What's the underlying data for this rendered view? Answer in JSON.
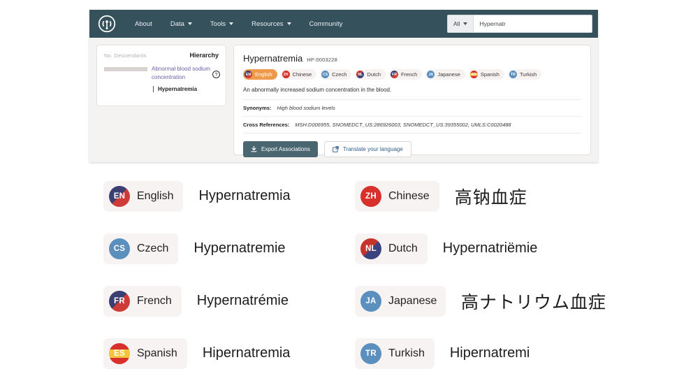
{
  "navbar": {
    "logo_icon": "broadcast-antenna-icon",
    "items": [
      {
        "label": "About",
        "has_caret": false
      },
      {
        "label": "Data",
        "has_caret": true
      },
      {
        "label": "Tools",
        "has_caret": true
      },
      {
        "label": "Resources",
        "has_caret": true
      },
      {
        "label": "Community",
        "has_caret": false
      }
    ],
    "search": {
      "scope_label": "All",
      "value": "Hypernatr",
      "placeholder": "Search"
    }
  },
  "hierarchy": {
    "descendants_label": "No. Descendants",
    "title": "Hierarchy",
    "parent_term": "Abnormal blood sodium concentration",
    "current_term": "Hypernatremia",
    "help_glyph": "?"
  },
  "term": {
    "name": "Hypernatremia",
    "id": "HP:0003228",
    "description": "An abnormally increased sodium concentration in the blood.",
    "synonyms_label": "Synonyms:",
    "synonyms_value": "High blood sodium levels",
    "xrefs_label": "Cross References:",
    "xrefs_value": "MSH:D006955, SNOMEDCT_US:286926003, SNOMEDCT_US:39355002, UMLS:C0020488",
    "chips": [
      {
        "code": "EN",
        "label": "English",
        "active": true
      },
      {
        "code": "ZH",
        "label": "Chinese",
        "active": false
      },
      {
        "code": "CS",
        "label": "Czech",
        "active": false
      },
      {
        "code": "NL",
        "label": "Dutch",
        "active": false
      },
      {
        "code": "FR",
        "label": "French",
        "active": false
      },
      {
        "code": "JA",
        "label": "Japanese",
        "active": false
      },
      {
        "code": "ES",
        "label": "Spanish",
        "active": false
      },
      {
        "code": "TR",
        "label": "Turkish",
        "active": false
      }
    ],
    "export_button": "Export Associations",
    "translate_button": "Translate your language"
  },
  "translations": [
    {
      "code": "EN",
      "language": "English",
      "text": "Hypernatremia",
      "cjk": false
    },
    {
      "code": "ZH",
      "language": "Chinese",
      "text": "高钠血症",
      "cjk": true
    },
    {
      "code": "CS",
      "language": "Czech",
      "text": "Hypernatremie",
      "cjk": false
    },
    {
      "code": "NL",
      "language": "Dutch",
      "text": "Hypernatriëmie",
      "cjk": false
    },
    {
      "code": "FR",
      "language": "French",
      "text": "Hypernatrémie",
      "cjk": false
    },
    {
      "code": "JA",
      "language": "Japanese",
      "text": "高ナトリウム血症",
      "cjk": true
    },
    {
      "code": "ES",
      "language": "Spanish",
      "text": "Hipernatremia",
      "cjk": false
    },
    {
      "code": "TR",
      "language": "Turkish",
      "text": "Hipernatremi",
      "cjk": false
    }
  ],
  "colors": {
    "navbar_bg": "#35515c",
    "accent_orange": "#ef9a4a",
    "link_purple": "#6a5fa8",
    "primary_button": "#4a6670",
    "pill_bg": "#f7f3f2"
  }
}
